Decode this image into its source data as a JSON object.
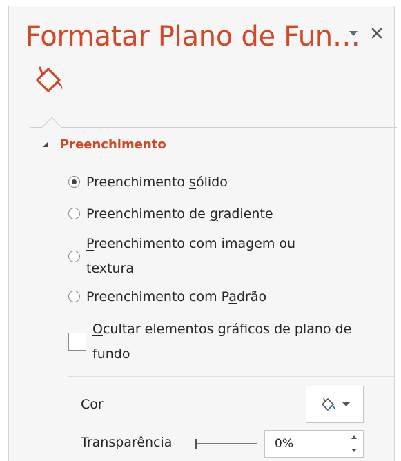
{
  "pane": {
    "title": "Formatar Plano de Fun…",
    "menu_icon": "dropdown-arrow-icon",
    "close_icon": "close-icon",
    "tab_icon": "paint-bucket-icon"
  },
  "colors": {
    "accent": "#d24726",
    "pane_bg": "#f6f6f6",
    "text": "#262626"
  },
  "section": {
    "title": "Preenchimento",
    "expanded": true
  },
  "fill_options": [
    {
      "pre": "Preenchimento ",
      "key": "s",
      "post": "ólido",
      "checked": true
    },
    {
      "pre": "Preenchimento de ",
      "key": "g",
      "post": "radiente",
      "checked": false
    },
    {
      "pre": "",
      "key": "P",
      "post": "reenchimento com imagem ou textura",
      "checked": false
    },
    {
      "pre": "Preenchimento com P",
      "key": "a",
      "post": "drão",
      "checked": false
    }
  ],
  "hide_background": {
    "key": "O",
    "post": "cultar elementos gráficos de plano de fundo",
    "checked": false
  },
  "color": {
    "pre": "Co",
    "key": "r",
    "post": "",
    "button_icon": "paint-bucket-icon",
    "dropdown_icon": "dropdown-arrow-icon"
  },
  "transparency": {
    "pre": "",
    "key": "T",
    "post": "ransparência",
    "value": "0%",
    "level": 0
  }
}
